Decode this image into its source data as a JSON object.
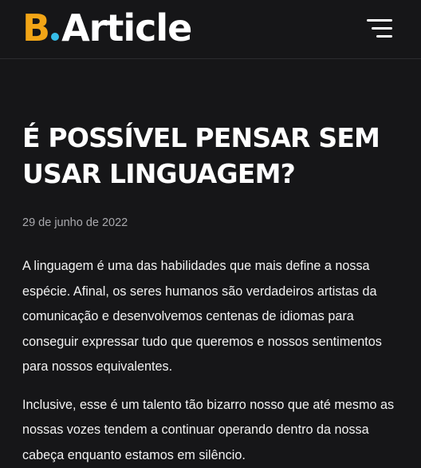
{
  "header": {
    "logo_letter": "B",
    "logo_word": "Article",
    "menu_icon": "hamburger-menu-icon",
    "colors": {
      "logo_letter": "#f2a516",
      "logo_dot": "#36bde8",
      "background": "#161618"
    }
  },
  "article": {
    "title": "É POSSÍVEL PENSAR SEM USAR LINGUAGEM?",
    "date": "29 de junho de 2022",
    "paragraphs": [
      "A linguagem é uma das habilidades que mais define a nossa espécie. Afinal, os seres humanos são verdadeiros artistas da comunicação e desenvolvemos centenas de idiomas para conseguir expressar tudo que queremos e nossos sentimentos para nossos equivalentes.",
      "Inclusive, esse é um talento tão bizarro nosso que até mesmo as nossas vozes tendem a continuar operando dentro da nossa cabeça enquanto estamos em silêncio."
    ]
  }
}
